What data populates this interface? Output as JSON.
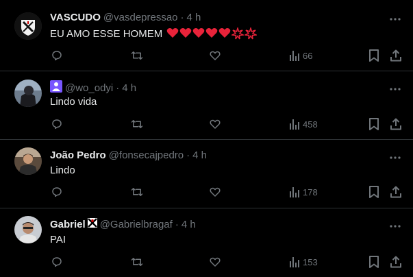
{
  "posts": [
    {
      "name": "VASCUDO",
      "handle": "@vasdepressao",
      "time": "4 h",
      "text": "EU AMO ESSE HOMEM",
      "emoji_hearts": 5,
      "emoji_bursts": 2,
      "badge": null,
      "views": "66"
    },
    {
      "name": "",
      "handle": "@wo_odyi",
      "time": "4 h",
      "text": "Lindo vida",
      "badge": "purple-profile-icon",
      "views": "458"
    },
    {
      "name": "João Pedro",
      "handle": "@fonsecajpedro",
      "time": "4 h",
      "text": "Lindo",
      "badge": null,
      "views": "178"
    },
    {
      "name": "Gabriel",
      "handle": "@Gabrielbragaf",
      "time": "4 h",
      "text": "PAI",
      "badge": "vasco-cross-icon",
      "views": "153"
    }
  ],
  "colors": {
    "background": "#000000",
    "text": "#e7e9ea",
    "muted": "#71767b",
    "divider": "#2f3336",
    "heart_emoji": "#e8233a",
    "badge_purple": "#7856ff"
  }
}
